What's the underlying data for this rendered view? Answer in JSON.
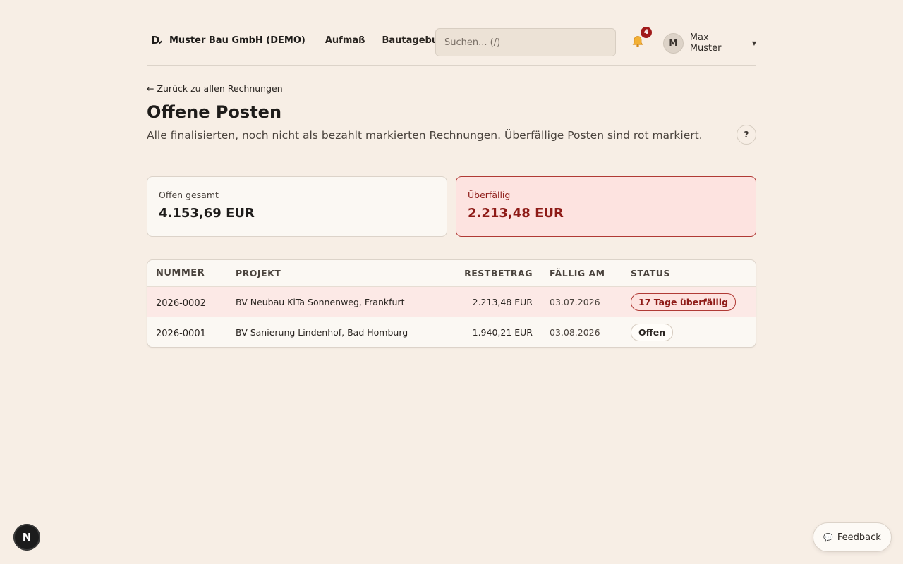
{
  "header": {
    "logo_text": "D",
    "company": "Muster Bau GmbH (DEMO)",
    "nav": [
      {
        "label": "Aufmaß"
      },
      {
        "label": "Bautagebuch"
      }
    ],
    "search_placeholder": "Suchen... (/)",
    "notifications_count": "4",
    "user": {
      "initial": "M",
      "name": "Max Muster"
    }
  },
  "page": {
    "back_link": "← Zurück zu allen Rechnungen",
    "title": "Offene Posten",
    "subtitle": "Alle finalisierten, noch nicht als bezahlt markierten Rechnungen. Überfällige Posten sind rot markiert.",
    "help_label": "?"
  },
  "summary": {
    "open": {
      "label": "Offen gesamt",
      "value": "4.153,69 EUR"
    },
    "overdue": {
      "label": "Überfällig",
      "value": "2.213,48 EUR"
    }
  },
  "table": {
    "columns": [
      "NUMMER",
      "PROJEKT",
      "RESTBETRAG",
      "FÄLLIG AM",
      "STATUS"
    ],
    "rows": [
      {
        "number": "2026-0002",
        "project": "BV Neubau KiTa Sonnenweg, Frankfurt",
        "amount": "2.213,48 EUR",
        "due": "03.07.2026",
        "status": "17 Tage überfällig"
      },
      {
        "number": "2026-0001",
        "project": "BV Sanierung Lindenhof, Bad Homburg",
        "amount": "1.940,21 EUR",
        "due": "03.08.2026",
        "status": "Offen"
      }
    ]
  },
  "floating": {
    "next_badge": "N",
    "feedback_label": "Feedback"
  },
  "colors": {
    "background": "#f7eee5",
    "overdue_text": "#8e1b17",
    "overdue_bg": "#fde3e0",
    "badge": "#a11a1a"
  }
}
